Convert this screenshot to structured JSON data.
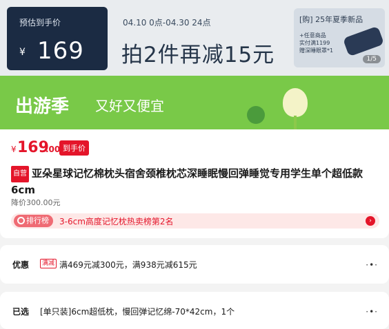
{
  "banner": {
    "estimate_label": "预估到手价",
    "currency": "¥",
    "estimate_price": "169",
    "date_range": "04.10 0点-04.30 24点",
    "promo": "拍2件再减15元",
    "new_title": "[购] 25年夏季新品",
    "new_lines": [
      "+任意商品",
      "实付满1199",
      "赠深睡眼罩*1"
    ],
    "page_indicator": "1/5"
  },
  "activity": {
    "title": "出游季",
    "subtitle": "又好又便宜"
  },
  "product": {
    "currency": "¥",
    "price_int": "169",
    "price_dec": ".00",
    "price_badge": "到手价",
    "self_label": "自营",
    "title": "亚朵星球记忆棉枕头宿舍颈椎枕芯深睡眠慢回弹睡觉专用学生单个超低款6cm",
    "original_price": "降价300.00元",
    "rank_label": "排行榜",
    "rank_text": "3-6cm高度记忆枕热卖榜第2名"
  },
  "discount": {
    "label": "优惠",
    "tag": "满减",
    "text": "满469元减300元，满938元减615元"
  },
  "selected": {
    "label": "已选",
    "text": "[单只装]6cm超低枕，慢回弹记忆绵-70*42cm，1个"
  },
  "colors": {
    "accent_red": "#e4152a",
    "banner_navy": "#1b2b43",
    "activity_green": "#79c948"
  }
}
